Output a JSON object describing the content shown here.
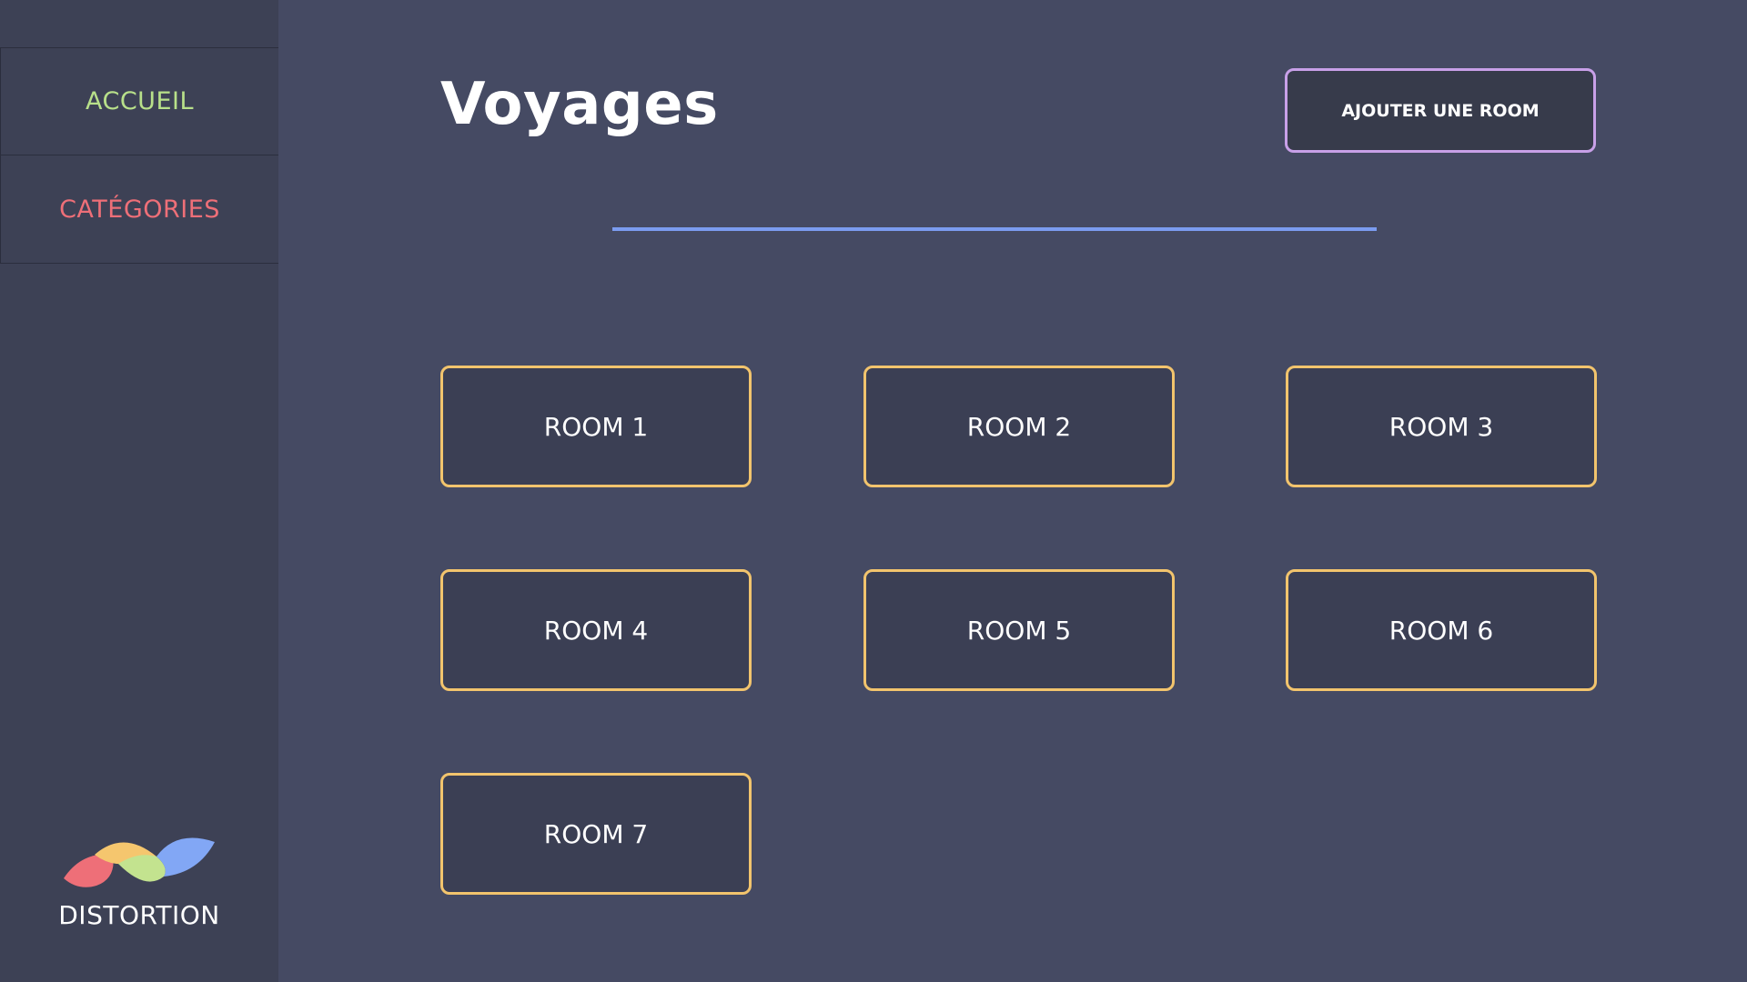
{
  "sidebar": {
    "items": [
      {
        "label": "ACCUEIL",
        "color": "#b8e08a"
      },
      {
        "label": "CATÉGORIES",
        "color": "#ee6f78"
      }
    ],
    "logo": {
      "text": "DISTORTION",
      "colors": [
        "#ee6f78",
        "#f5c66e",
        "#c3e38f",
        "#82a7f5"
      ]
    }
  },
  "main": {
    "title": "Voyages",
    "add_button_label": "AJOUTER UNE ROOM",
    "rooms": [
      {
        "label": "ROOM 1"
      },
      {
        "label": "ROOM 2"
      },
      {
        "label": "ROOM 3"
      },
      {
        "label": "ROOM 4"
      },
      {
        "label": "ROOM 5"
      },
      {
        "label": "ROOM 6"
      },
      {
        "label": "ROOM 7"
      }
    ]
  },
  "colors": {
    "background": "#454a63",
    "sidebar": "#3d4155",
    "divider": "#7b9cf0",
    "card_border": "#f2c46d",
    "button_border": "#c8a0e8"
  }
}
